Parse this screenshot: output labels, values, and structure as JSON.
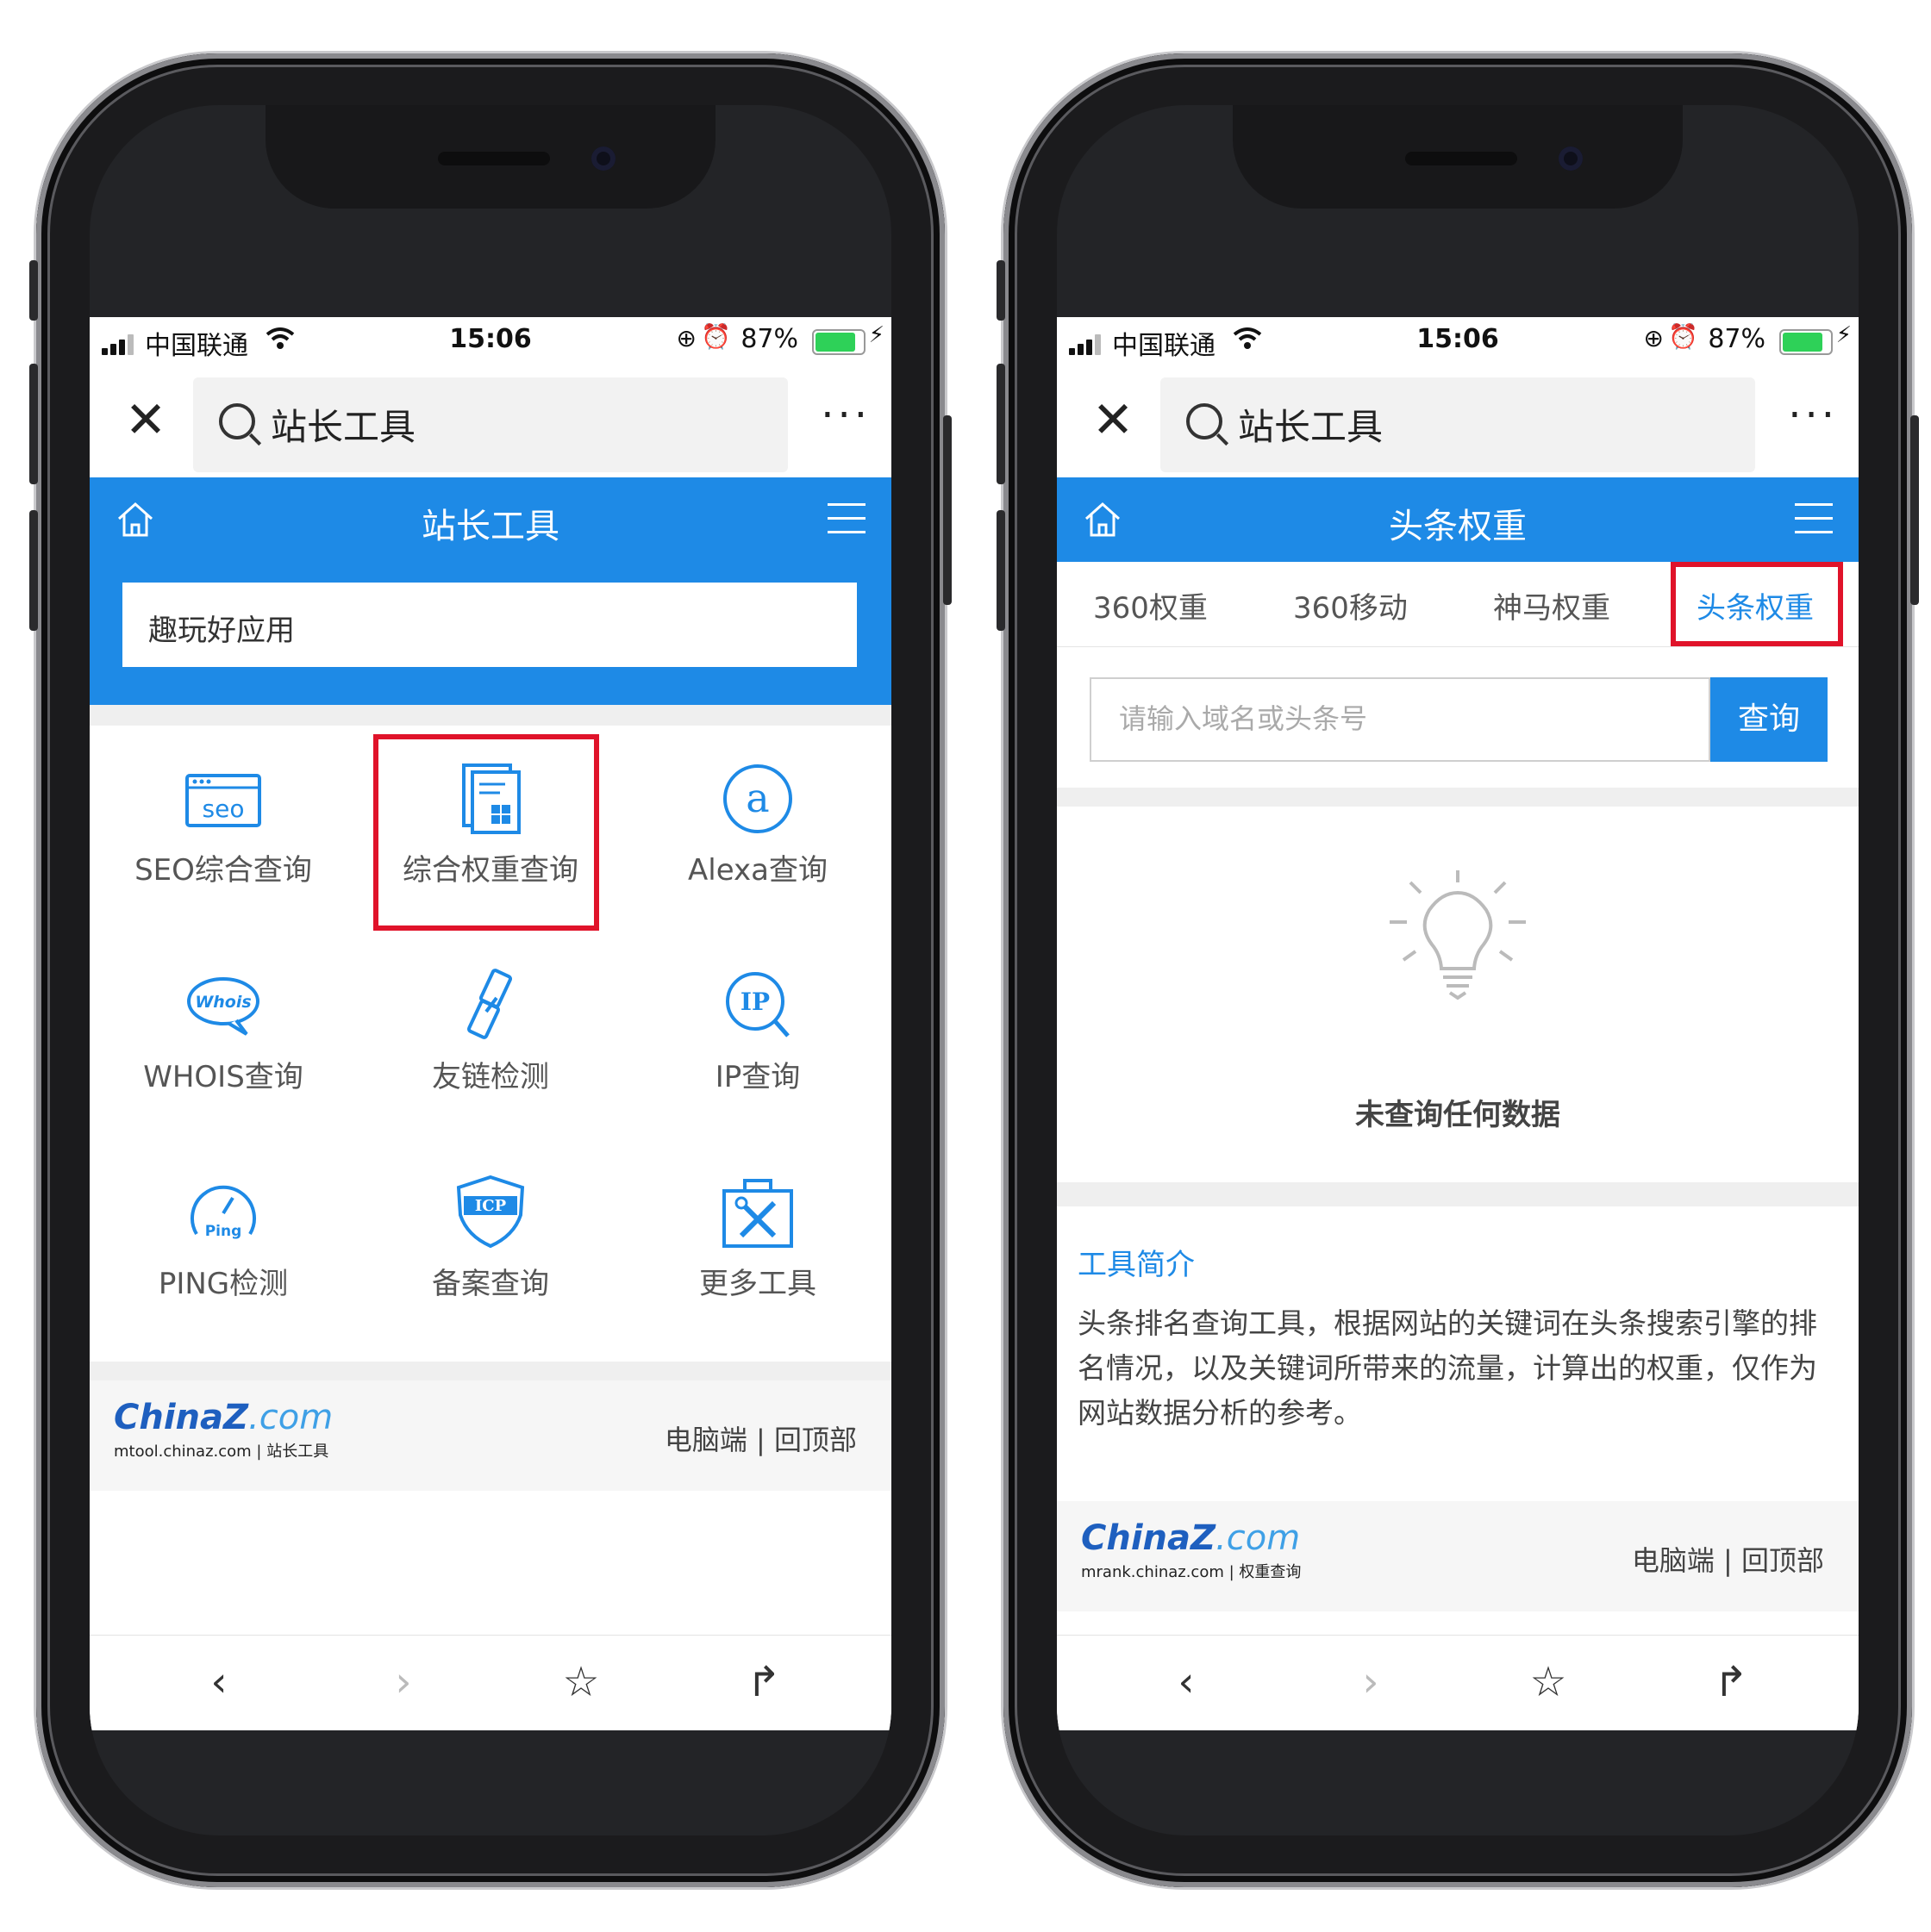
{
  "status_bar": {
    "carrier": "中国联通",
    "time": "15:06",
    "battery": "87%",
    "battery_level": 0.87
  },
  "wechat_nav": {
    "search_text": "站长工具",
    "more": "···"
  },
  "left_screen": {
    "header_title": "站长工具",
    "search_box_text": "趣玩好应用",
    "tools": [
      {
        "label": "SEO综合查询",
        "icon": "seo-icon"
      },
      {
        "label": "综合权重查询",
        "icon": "document-chart-icon"
      },
      {
        "label": "Alexa查询",
        "icon": "alexa-icon"
      },
      {
        "label": "WHOIS查询",
        "icon": "whois-icon"
      },
      {
        "label": "友链检测",
        "icon": "link-icon"
      },
      {
        "label": "IP查询",
        "icon": "ip-search-icon"
      },
      {
        "label": "PING检测",
        "icon": "ping-gauge-icon"
      },
      {
        "label": "备案查询",
        "icon": "icp-shield-icon"
      },
      {
        "label": "更多工具",
        "icon": "toolbox-icon"
      }
    ],
    "footer": {
      "logo_brand": "ChinaZ",
      "logo_tld": ".com",
      "logo_sub": "mtool.chinaz.com | 站长工具",
      "links": "电脑端 | 回顶部"
    }
  },
  "right_screen": {
    "header_title": "头条权重",
    "tabs": [
      "360权重",
      "360移动",
      "神马权重",
      "头条权重"
    ],
    "search": {
      "placeholder": "请输入域名或头条号",
      "button": "查询"
    },
    "empty_message": "未查询任何数据",
    "intro_title": "工具简介",
    "intro_text": "头条排名查询工具，根据网站的关键词在头条搜索引擎的排名情况，以及关键词所带来的流量，计算出的权重，仅作为网站数据分析的参考。",
    "footer": {
      "logo_brand": "ChinaZ",
      "logo_tld": ".com",
      "logo_sub": "mrank.chinaz.com | 权重查询",
      "links": "电脑端 | 回顶部"
    }
  },
  "colors": {
    "brand_blue": "#1e8ae6",
    "highlight_red": "#e0132a"
  }
}
